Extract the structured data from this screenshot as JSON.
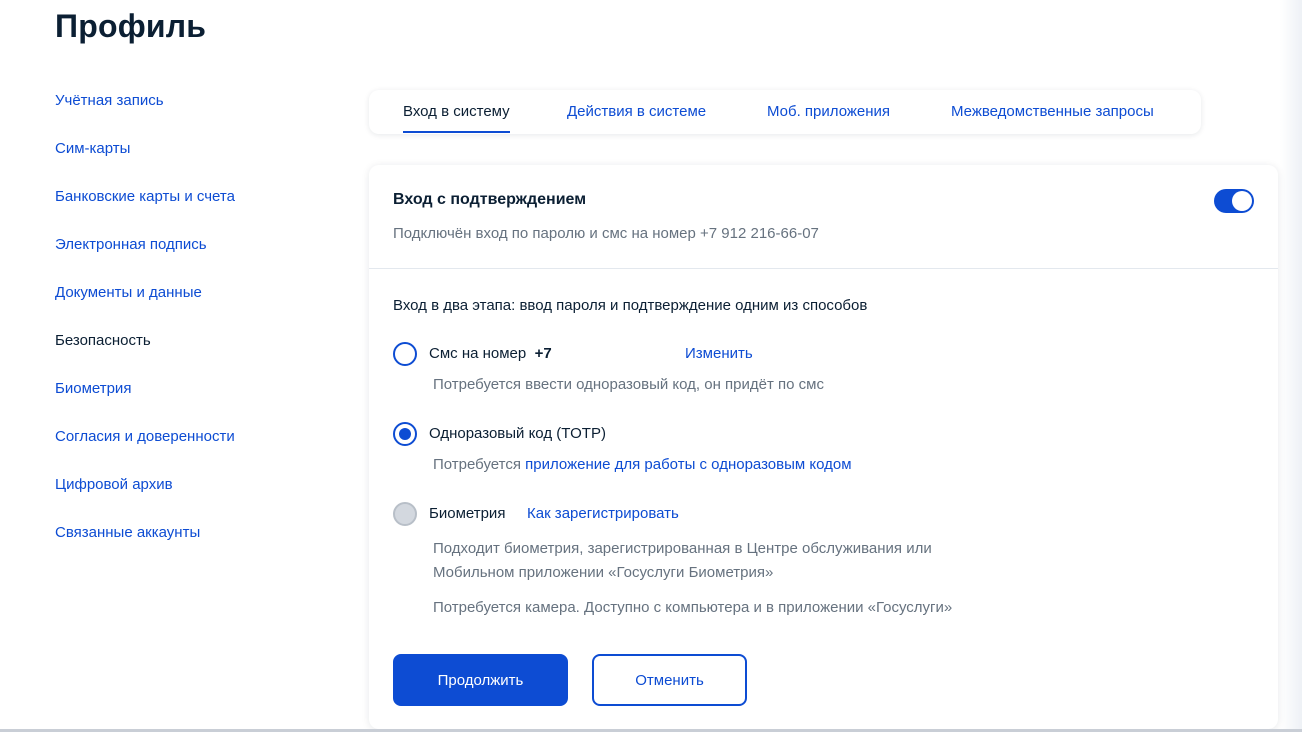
{
  "page": {
    "title": "Профиль"
  },
  "sidebar": {
    "items": [
      {
        "label": "Учётная запись"
      },
      {
        "label": "Сим-карты"
      },
      {
        "label": "Банковские карты и счета"
      },
      {
        "label": "Электронная подпись"
      },
      {
        "label": "Документы и данные"
      },
      {
        "label": "Безопасность",
        "active": true
      },
      {
        "label": "Биометрия"
      },
      {
        "label": "Согласия и доверенности"
      },
      {
        "label": "Цифровой архив"
      },
      {
        "label": "Связанные аккаунты"
      }
    ]
  },
  "tabs": [
    {
      "label": "Вход в систему",
      "active": true
    },
    {
      "label": "Действия в системе"
    },
    {
      "label": "Моб. приложения"
    },
    {
      "label": "Межведомственные запросы"
    }
  ],
  "card": {
    "title": "Вход с подтверждением",
    "subtitle": "Подключён вход по паролю и смс на номер +7 912 216-66-07",
    "toggle_on": true,
    "section_title": "Вход в два этапа: ввод пароля и подтверждение одним из способов",
    "options": {
      "sms": {
        "label": "Смс на номер",
        "number": "+7",
        "selected": false,
        "link": "Изменить",
        "hint": "Потребуется ввести одноразовый код, он придёт по смс"
      },
      "totp": {
        "label": "Одноразовый код (TOTP)",
        "selected": true,
        "hint_prefix": "Потребуется",
        "hint_link": "приложение для работы с одноразовым кодом"
      },
      "biometry": {
        "label": "Биометрия",
        "selected": false,
        "disabled": true,
        "link": "Как зарегистрировать",
        "hint_line1": "Подходит биометрия, зарегистрированная в Центре обслуживания или",
        "hint_line2": "Мобильном приложении «Госуслуги Биометрия»",
        "hint_extra": "Потребуется камера. Доступно с компьютера и в приложении «Госуслуги»"
      }
    },
    "buttons": {
      "continue": "Продолжить",
      "cancel": "Отменить"
    }
  },
  "colors": {
    "accent": "#0d4cd3",
    "text": "#0b1f33",
    "muted": "#66727f",
    "disabled_radio": "#d3d8df"
  }
}
